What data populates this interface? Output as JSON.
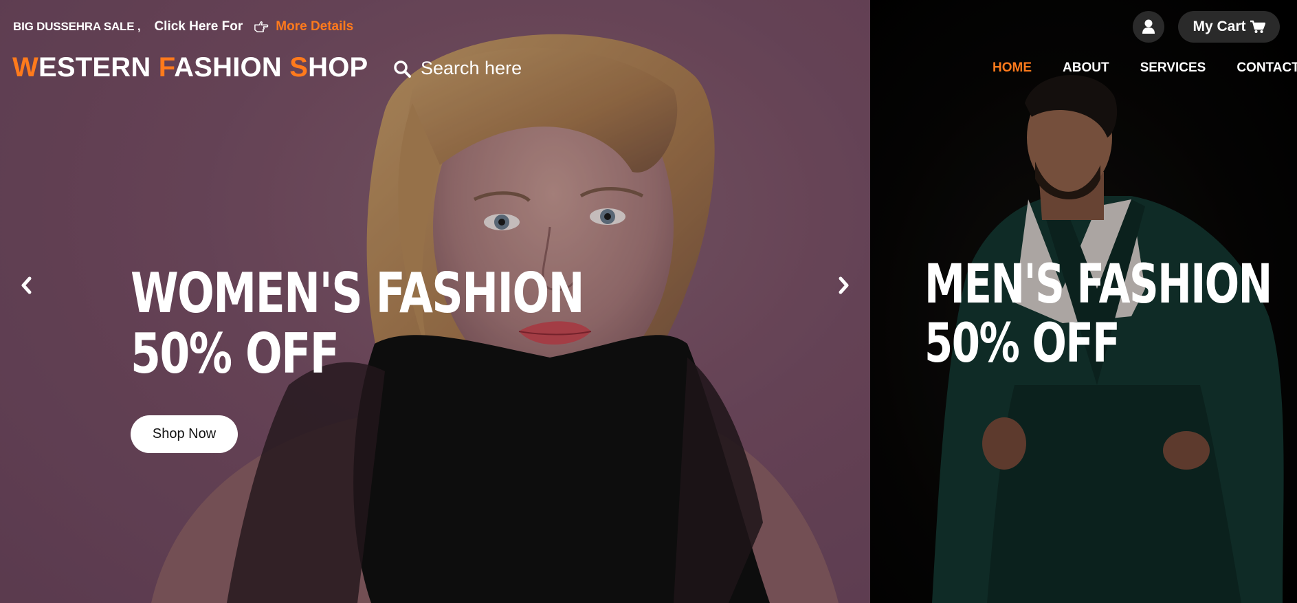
{
  "topbar": {
    "sale_label": "BIG DUSSEHRA SALE ,",
    "click_text": "Click Here For",
    "more_link": "More Details"
  },
  "logo": {
    "part1_accent": "W",
    "part1_rest": "ESTERN ",
    "part2_accent": "F",
    "part2_rest": "ASHION ",
    "part3_accent": "S",
    "part3_rest": "HOP"
  },
  "search": {
    "placeholder": "Search here"
  },
  "account": {
    "cart_label": "My Cart"
  },
  "nav": {
    "items": [
      {
        "label": "HOME",
        "active": true
      },
      {
        "label": "ABOUT"
      },
      {
        "label": "SERVICES"
      },
      {
        "label": "CONTACT"
      }
    ]
  },
  "hero": {
    "women_line1": "WOMEN'S FASHION",
    "women_line2": "50% OFF",
    "shop_button": "Shop Now",
    "men_line1": "MEN'S FASHION",
    "men_line2": "50% OFF"
  },
  "icons": {
    "user": "user-icon",
    "cart": "cart-icon",
    "search": "search-icon",
    "hand": "hand-pointing-right-icon",
    "prev": "chevron-left-icon",
    "next": "chevron-right-icon"
  },
  "colors": {
    "accent": "#ff7a1c",
    "women_panel": "#7b5168",
    "men_panel": "#070605",
    "pill_dark": "#2a2a2a"
  }
}
